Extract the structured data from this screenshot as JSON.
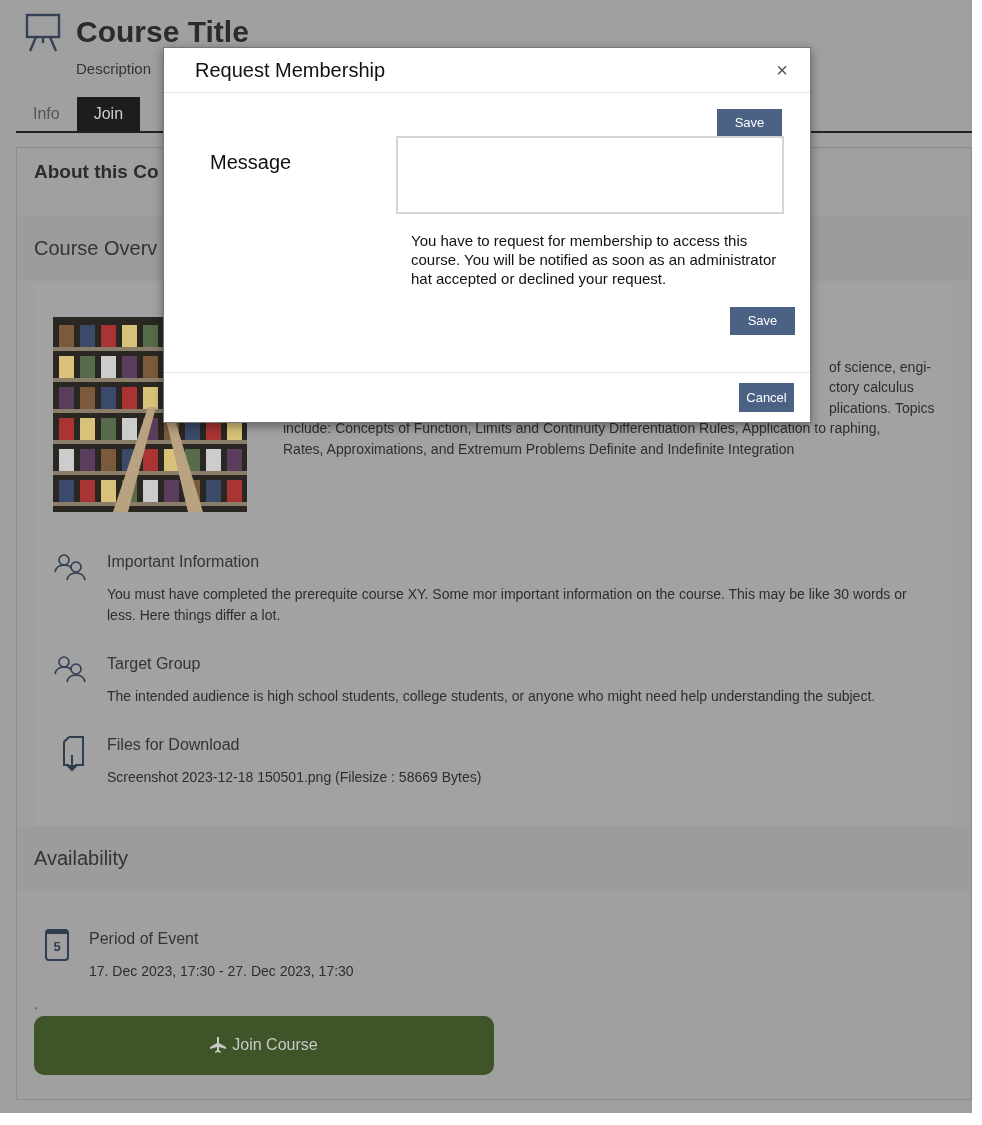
{
  "page": {
    "title": "Course Title",
    "description": "Description"
  },
  "tabs": [
    {
      "label": "Info",
      "selected": false
    },
    {
      "label": "Join",
      "selected": true
    }
  ],
  "card": {
    "title": "About this Co"
  },
  "overview": {
    "heading": "Course Overv",
    "image": {
      "kind": "picture"
    },
    "fragments": [
      "of science, engi-",
      "ctory calculus",
      "plications. Topics"
    ],
    "lines": [
      "include: Concepts of Function, Limits and Continuity Differentiation Rules, Application to raphing,",
      "Rates, Approximations, and Extremum Problems Definite and Indefinite Integration"
    ]
  },
  "info_items": [
    {
      "kind": "people",
      "title": "Important Information",
      "text": "You must have completed the prerequite course XY. Some mor important information on the course. This may be like 30 words or less. Here things differ a lot."
    },
    {
      "kind": "people",
      "title": "Target Group",
      "text": "The intended audience is high school students, college students, or anyone who might need help understanding the subject."
    },
    {
      "kind": "file",
      "title": "Files for Download",
      "text": "Screenshot 2023-12-18 150501.png (Filesize : 58669 Bytes)"
    }
  ],
  "availability": {
    "heading": "Availability",
    "items": [
      {
        "kind": "calendar",
        "badge": "5",
        "title": "Period of Event",
        "text": "17. Dec 2023, 17:30 - 27. Dec 2023, 17:30"
      }
    ]
  },
  "dot": ".",
  "join_button": {
    "label": "Join Course"
  },
  "dialog": {
    "title": "Request Membership",
    "close": "×",
    "top_button": "Save",
    "message_label": "Message",
    "help": "You have to request for membership to access this course. You will be notified as soon as an administrator hat accepted or declined your request.",
    "save": "Save",
    "cancel": "Cancel"
  }
}
